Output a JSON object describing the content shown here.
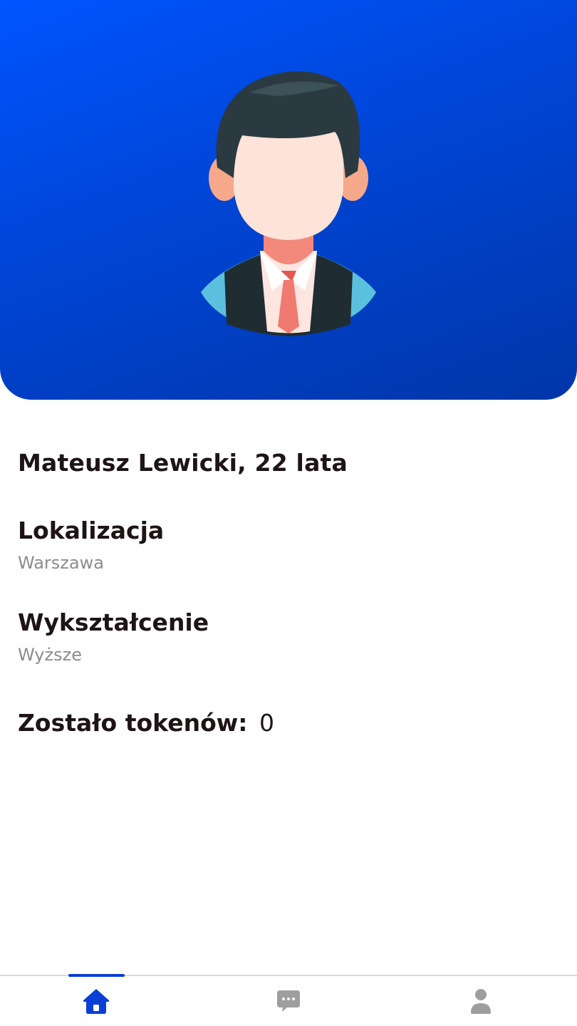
{
  "profile": {
    "name_age": "Mateusz Lewicki, 22 lata",
    "location_title": "Lokalizacja",
    "location_value": "Warszawa",
    "education_title": "Wykształcenie",
    "education_value": "Wyższe",
    "tokens_label": "Zostało tokenów:",
    "tokens_value": "0"
  },
  "nav": {
    "active": "home",
    "items": [
      "home-icon",
      "chat-icon",
      "person-icon"
    ]
  },
  "colors": {
    "hero_start": "#0055ff",
    "hero_end": "#0036a8",
    "active_nav": "#0a3fd6",
    "inactive_nav": "#9e9e9e"
  }
}
